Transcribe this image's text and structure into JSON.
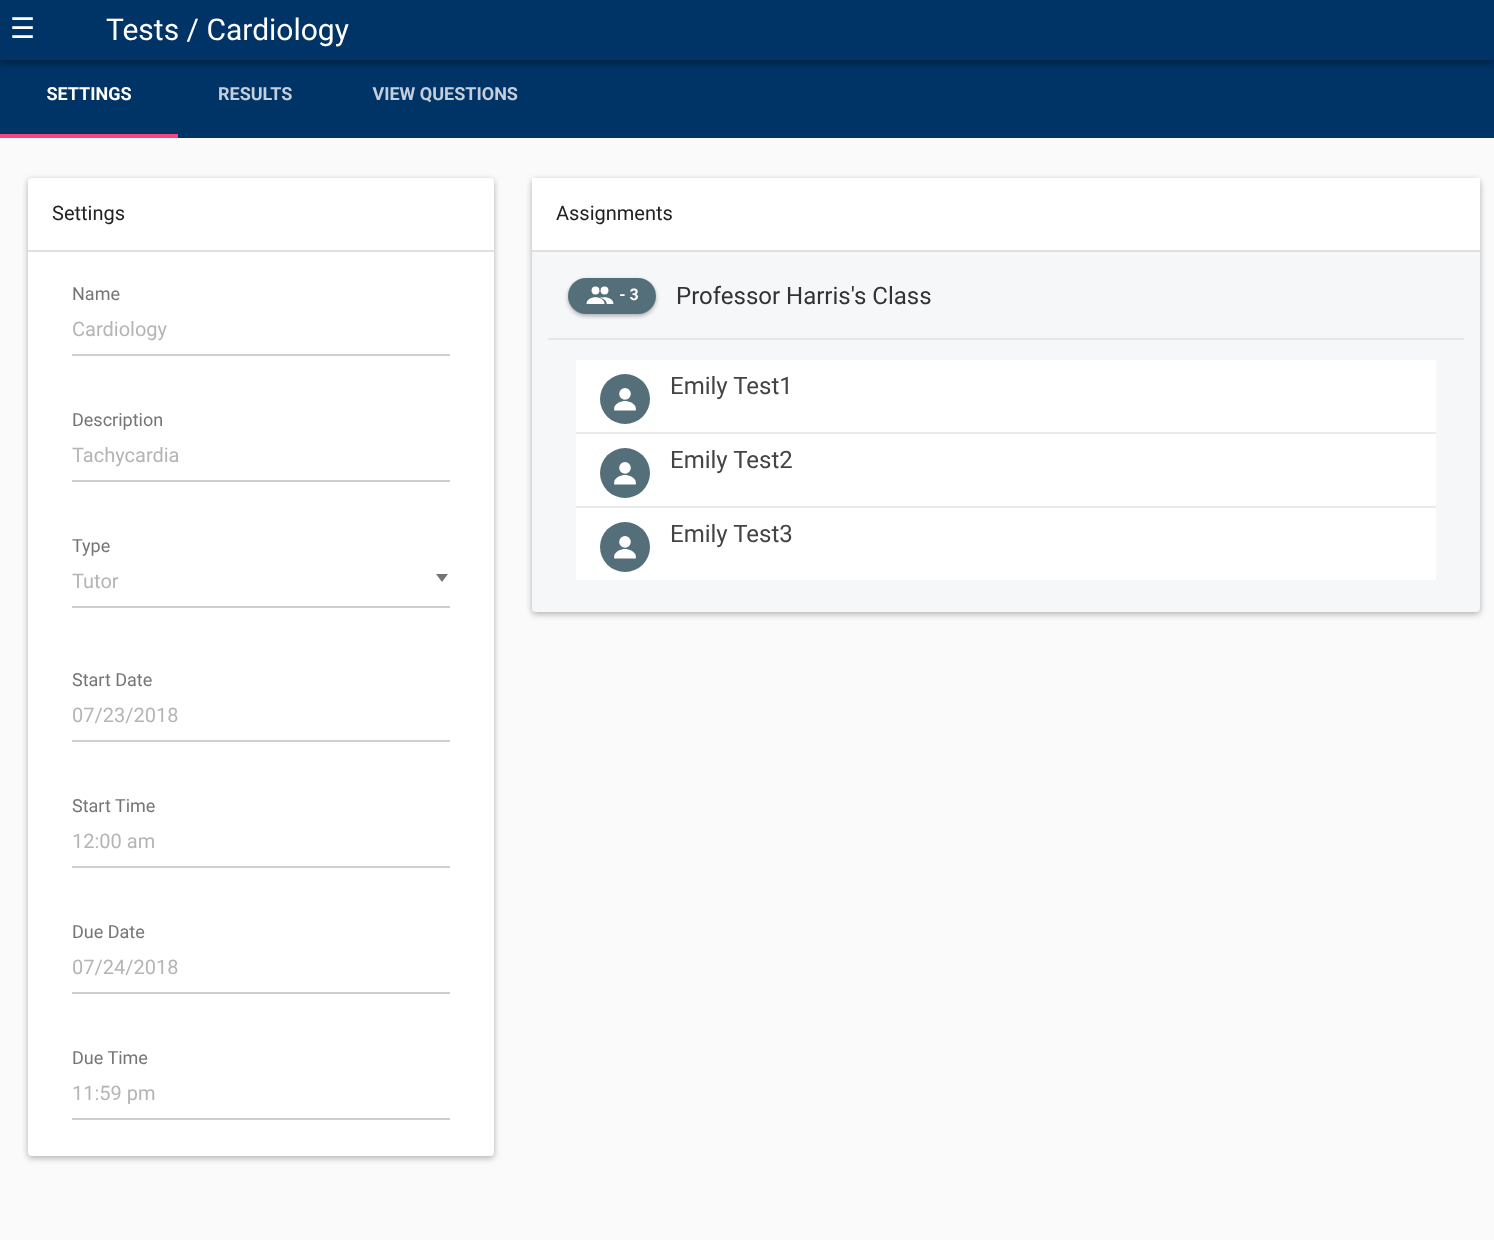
{
  "app_bar": {
    "menu_icon": "☰",
    "title": "Tests / Cardiology"
  },
  "tabs": [
    {
      "label": "SETTINGS",
      "selected": true
    },
    {
      "label": "RESULTS",
      "selected": false
    },
    {
      "label": "VIEW QUESTIONS",
      "selected": false
    }
  ],
  "settings": {
    "title": "Settings",
    "fields": [
      {
        "kind": "text",
        "label": "Name",
        "value": "Cardiology"
      },
      {
        "kind": "text",
        "label": "Description",
        "value": "Tachycardia"
      },
      {
        "kind": "select",
        "label": "Type",
        "value": "Tutor"
      },
      {
        "kind": "text",
        "label": "Start Date",
        "value": "07/23/2018"
      },
      {
        "kind": "text",
        "label": "Start Time",
        "value": "12:00 am"
      },
      {
        "kind": "text",
        "label": "Due Date",
        "value": "07/24/2018"
      },
      {
        "kind": "text",
        "label": "Due Time",
        "value": "11:59 pm"
      }
    ]
  },
  "assignments": {
    "title": "Assignments",
    "groups": [
      {
        "count": "- 3",
        "name": "Professor Harris's Class",
        "members": [
          {
            "name": "Emily Test1"
          },
          {
            "name": "Emily Test2"
          },
          {
            "name": "Emily Test3"
          }
        ]
      }
    ]
  }
}
